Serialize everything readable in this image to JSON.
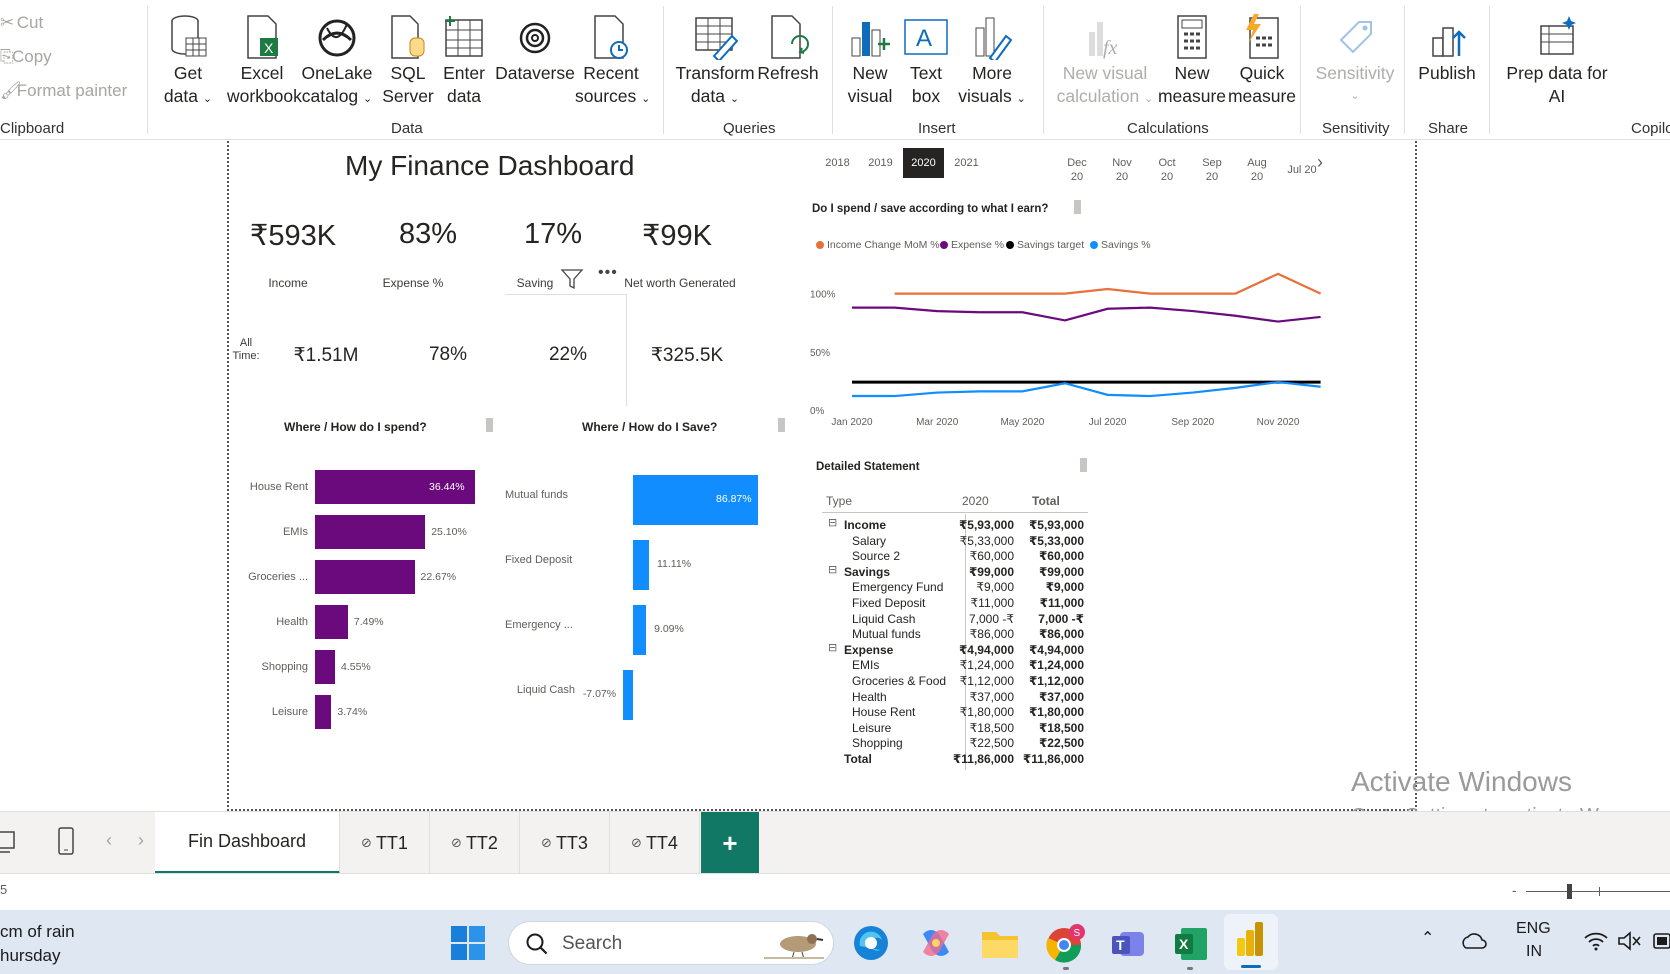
{
  "ribbon": {
    "clipboard": {
      "cut": "Cut",
      "copy": "Copy",
      "format_painter": "Format painter",
      "group": "Clipboard"
    },
    "data": {
      "get_data": [
        "Get",
        "data"
      ],
      "excel": [
        "Excel",
        "workbook"
      ],
      "onelake": [
        "OneLake",
        "catalog"
      ],
      "sql": [
        "SQL",
        "Server"
      ],
      "enter": [
        "Enter",
        "data"
      ],
      "dataverse": [
        "Dataverse",
        ""
      ],
      "recent": [
        "Recent",
        "sources"
      ],
      "group": "Data"
    },
    "queries": {
      "transform": [
        "Transform",
        "data"
      ],
      "refresh": [
        "Refresh",
        ""
      ],
      "group": "Queries"
    },
    "insert": {
      "new_visual": [
        "New",
        "visual"
      ],
      "text_box": [
        "Text",
        "box"
      ],
      "more_visuals": [
        "More",
        "visuals"
      ],
      "group": "Insert"
    },
    "calculations": {
      "new_visual_calc": [
        "New visual",
        "calculation"
      ],
      "new_measure": [
        "New",
        "measure"
      ],
      "quick_measure": [
        "Quick",
        "measure"
      ],
      "group": "Calculations"
    },
    "sensitivity": {
      "label": "Sensitivity",
      "group": "Sensitivity"
    },
    "share": {
      "publish": "Publish",
      "group": "Share"
    },
    "copilot": {
      "prep": [
        "Prep data for",
        "AI"
      ],
      "group": "Copilo"
    }
  },
  "dashboard": {
    "title": "My Finance Dashboard",
    "kpis": [
      {
        "value": "₹593K",
        "label": "Income"
      },
      {
        "value": "83%",
        "label": "Expense %"
      },
      {
        "value": "17%",
        "label": "Saving"
      },
      {
        "value": "₹99K",
        "label": "Net worth Generated"
      }
    ],
    "all_time_label": "All Time:",
    "all_time": [
      "₹1.51M",
      "78%",
      "22%",
      "₹325.5K"
    ],
    "years": [
      "2018",
      "2019",
      "2020",
      "2021"
    ],
    "selected_year": "2020",
    "months": [
      [
        "Dec",
        "20"
      ],
      [
        "Nov",
        "20"
      ],
      [
        "Oct",
        "20"
      ],
      [
        "Sep",
        "20"
      ],
      [
        "Aug",
        "20"
      ],
      [
        "Jul 20",
        ""
      ]
    ],
    "spend_title": "Where / How do I spend?",
    "save_title": "Where / How do I Save?",
    "line_title": "Do I spend / save according to what I earn?",
    "table_title": "Detailed Statement"
  },
  "chart_data": [
    {
      "type": "bar",
      "title": "Where / How do I spend?",
      "categories": [
        "House Rent",
        "EMIs",
        "Groceries ...",
        "Health",
        "Shopping",
        "Leisure"
      ],
      "values": [
        36.44,
        25.1,
        22.67,
        7.49,
        4.55,
        3.74
      ],
      "labels": [
        "36.44%",
        "25.10%",
        "22.67%",
        "7.49%",
        "4.55%",
        "3.74%"
      ],
      "color": "#6b0a7d"
    },
    {
      "type": "bar",
      "title": "Where / How do I Save?",
      "categories": [
        "Mutual funds",
        "Fixed Deposit",
        "Emergency ...",
        "Liquid Cash"
      ],
      "values": [
        86.87,
        11.11,
        9.09,
        -7.07
      ],
      "labels": [
        "86.87%",
        "11.11%",
        "9.09%",
        "-7.07%"
      ],
      "color": "#118dff"
    },
    {
      "type": "line",
      "title": "Do I spend / save according to what I earn?",
      "x": [
        "Jan 2020",
        "Feb 2020",
        "Mar 2020",
        "Apr 2020",
        "May 2020",
        "Jun 2020",
        "Jul 2020",
        "Aug 2020",
        "Sep 2020",
        "Oct 2020",
        "Nov 2020",
        "Dec 2020"
      ],
      "xticks": [
        "Jan 2020",
        "Mar 2020",
        "May 2020",
        "Jul 2020",
        "Sep 2020",
        "Nov 2020"
      ],
      "yticks": [
        "100%",
        "50%",
        "0%"
      ],
      "ylim": [
        0,
        1.1
      ],
      "series": [
        {
          "name": "Income Change MoM %",
          "color": "#e8703a",
          "values": [
            null,
            1.0,
            1.0,
            1.0,
            1.0,
            1.0,
            1.04,
            1.0,
            1.0,
            1.0,
            1.17,
            1.0
          ]
        },
        {
          "name": "Expense %",
          "color": "#6b0a7d",
          "values": [
            0.88,
            0.88,
            0.85,
            0.84,
            0.84,
            0.77,
            0.87,
            0.88,
            0.85,
            0.81,
            0.76,
            0.8
          ]
        },
        {
          "name": "Savings target",
          "color": "#000000",
          "values": [
            0.24,
            0.24,
            0.24,
            0.24,
            0.24,
            0.24,
            0.24,
            0.24,
            0.24,
            0.24,
            0.24,
            0.24
          ]
        },
        {
          "name": "Savings %",
          "color": "#118dff",
          "values": [
            0.12,
            0.12,
            0.15,
            0.16,
            0.16,
            0.23,
            0.13,
            0.12,
            0.15,
            0.19,
            0.24,
            0.2
          ]
        }
      ]
    },
    {
      "type": "table",
      "title": "Detailed Statement",
      "columns": [
        "Type",
        "2020",
        "Total"
      ],
      "rows": [
        {
          "type": "Income",
          "level": 0,
          "v2020": "₹5,93,000",
          "total": "₹5,93,000"
        },
        {
          "type": "Salary",
          "level": 1,
          "v2020": "₹5,33,000",
          "total": "₹5,33,000"
        },
        {
          "type": "Source 2",
          "level": 1,
          "v2020": "₹60,000",
          "total": "₹60,000"
        },
        {
          "type": "Savings",
          "level": 0,
          "v2020": "₹99,000",
          "total": "₹99,000"
        },
        {
          "type": "Emergency Fund",
          "level": 1,
          "v2020": "₹9,000",
          "total": "₹9,000"
        },
        {
          "type": "Fixed Deposit",
          "level": 1,
          "v2020": "₹11,000",
          "total": "₹11,000"
        },
        {
          "type": "Liquid Cash",
          "level": 1,
          "v2020": "7,000 -₹",
          "total": "7,000 -₹"
        },
        {
          "type": "Mutual funds",
          "level": 1,
          "v2020": "₹86,000",
          "total": "₹86,000"
        },
        {
          "type": "Expense",
          "level": 0,
          "v2020": "₹4,94,000",
          "total": "₹4,94,000"
        },
        {
          "type": "EMIs",
          "level": 1,
          "v2020": "₹1,24,000",
          "total": "₹1,24,000"
        },
        {
          "type": "Groceries & Food",
          "level": 1,
          "v2020": "₹1,12,000",
          "total": "₹1,12,000"
        },
        {
          "type": "Health",
          "level": 1,
          "v2020": "₹37,000",
          "total": "₹37,000"
        },
        {
          "type": "House Rent",
          "level": 1,
          "v2020": "₹1,80,000",
          "total": "₹1,80,000"
        },
        {
          "type": "Leisure",
          "level": 1,
          "v2020": "₹18,500",
          "total": "₹18,500"
        },
        {
          "type": "Shopping",
          "level": 1,
          "v2020": "₹22,500",
          "total": "₹22,500"
        },
        {
          "type": "Total",
          "level": -1,
          "v2020": "₹11,86,000",
          "total": "₹11,86,000"
        }
      ]
    }
  ],
  "tabs": [
    "Fin Dashboard",
    "TT1",
    "TT2",
    "TT3",
    "TT4"
  ],
  "add_tab": "+",
  "watermark": {
    "line1": "Activate Windows",
    "line2": "Go to Settings to activate W"
  },
  "status": {
    "left": "5"
  },
  "taskbar": {
    "weather1": "cm of rain",
    "weather2": "hursday",
    "search": "Search",
    "lang1": "ENG",
    "lang2": "IN",
    "badge": "S"
  }
}
